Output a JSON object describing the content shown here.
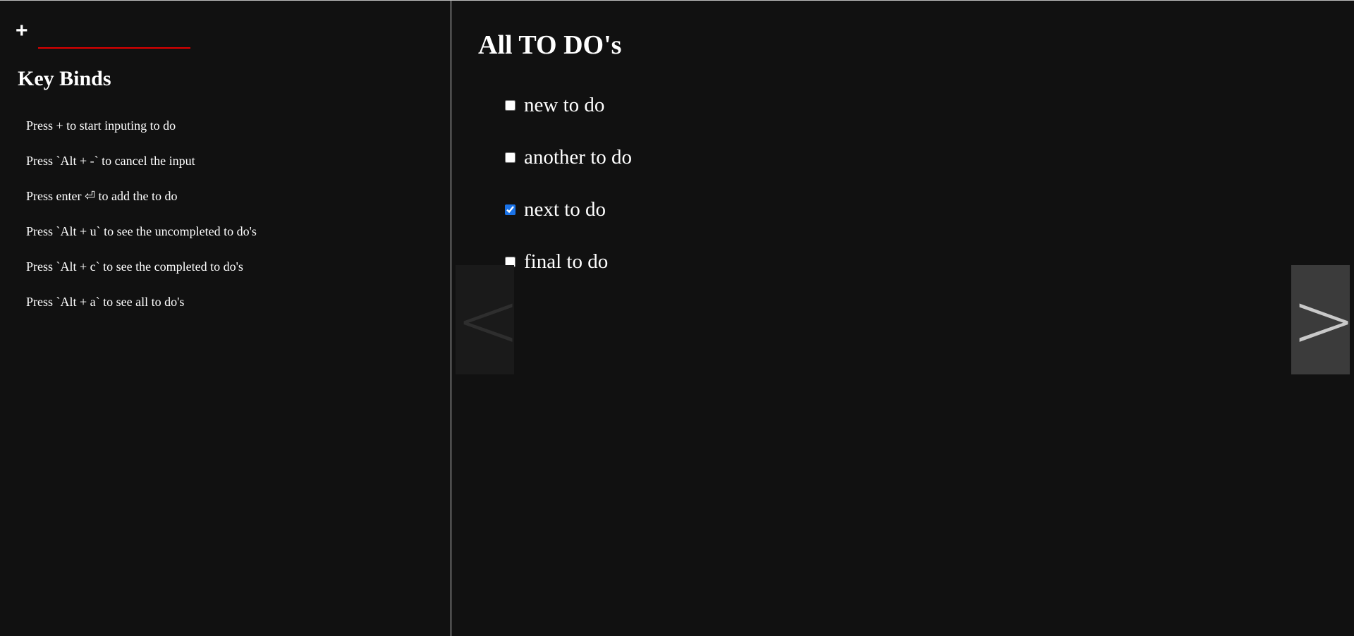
{
  "input": {
    "add_symbol": "+",
    "value": "",
    "placeholder": ""
  },
  "key_binds": {
    "title": "Key Binds",
    "items": [
      "Press + to start inputing to do",
      "Press `Alt + -` to cancel the input",
      "Press enter ⏎ to add the to do",
      "Press `Alt + u` to see the uncompleted to do's",
      "Press `Alt + c` to see the completed to do's",
      "Press `Alt + a` to see all to do's"
    ]
  },
  "view": {
    "title": "All TO DO's",
    "todos": [
      {
        "text": "new to do",
        "completed": false
      },
      {
        "text": "another to do",
        "completed": false
      },
      {
        "text": "next to do",
        "completed": true
      },
      {
        "text": "final to do",
        "completed": false
      }
    ]
  },
  "nav": {
    "prev_symbol": "<",
    "next_symbol": ">"
  },
  "colors": {
    "background": "#111111",
    "input_underline": "#e00000",
    "checkbox_accent": "#1a73e8",
    "next_button_bg": "#3b3b3b",
    "prev_button_bg": "#1a1a1a"
  }
}
